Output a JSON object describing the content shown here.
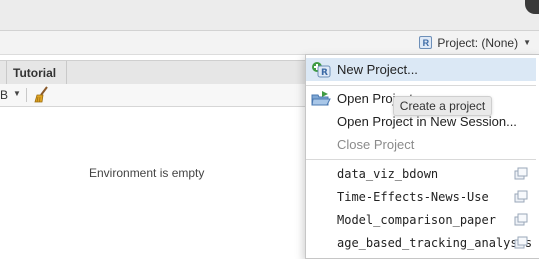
{
  "header": {
    "project_menu_label": "Project: (None)"
  },
  "tabs": {
    "tutorial_label": "Tutorial"
  },
  "toolbar": {
    "memory_unit": "B"
  },
  "environment": {
    "empty_text": "Environment is empty"
  },
  "project_menu": {
    "new_project": "New Project...",
    "open_project": "Open Project...",
    "open_in_new_session": "Open Project in New Session...",
    "close_project": "Close Project",
    "recent_projects": [
      "data_viz_bdown",
      "Time-Effects-News-Use",
      "Model_comparison_paper",
      "age_based_tracking_analysis"
    ]
  },
  "tooltip": {
    "text": "Create a project"
  },
  "colors": {
    "highlight": "#dbe8f5",
    "accent_blue": "#3c6aa5",
    "green_plus": "#3f9b43"
  }
}
